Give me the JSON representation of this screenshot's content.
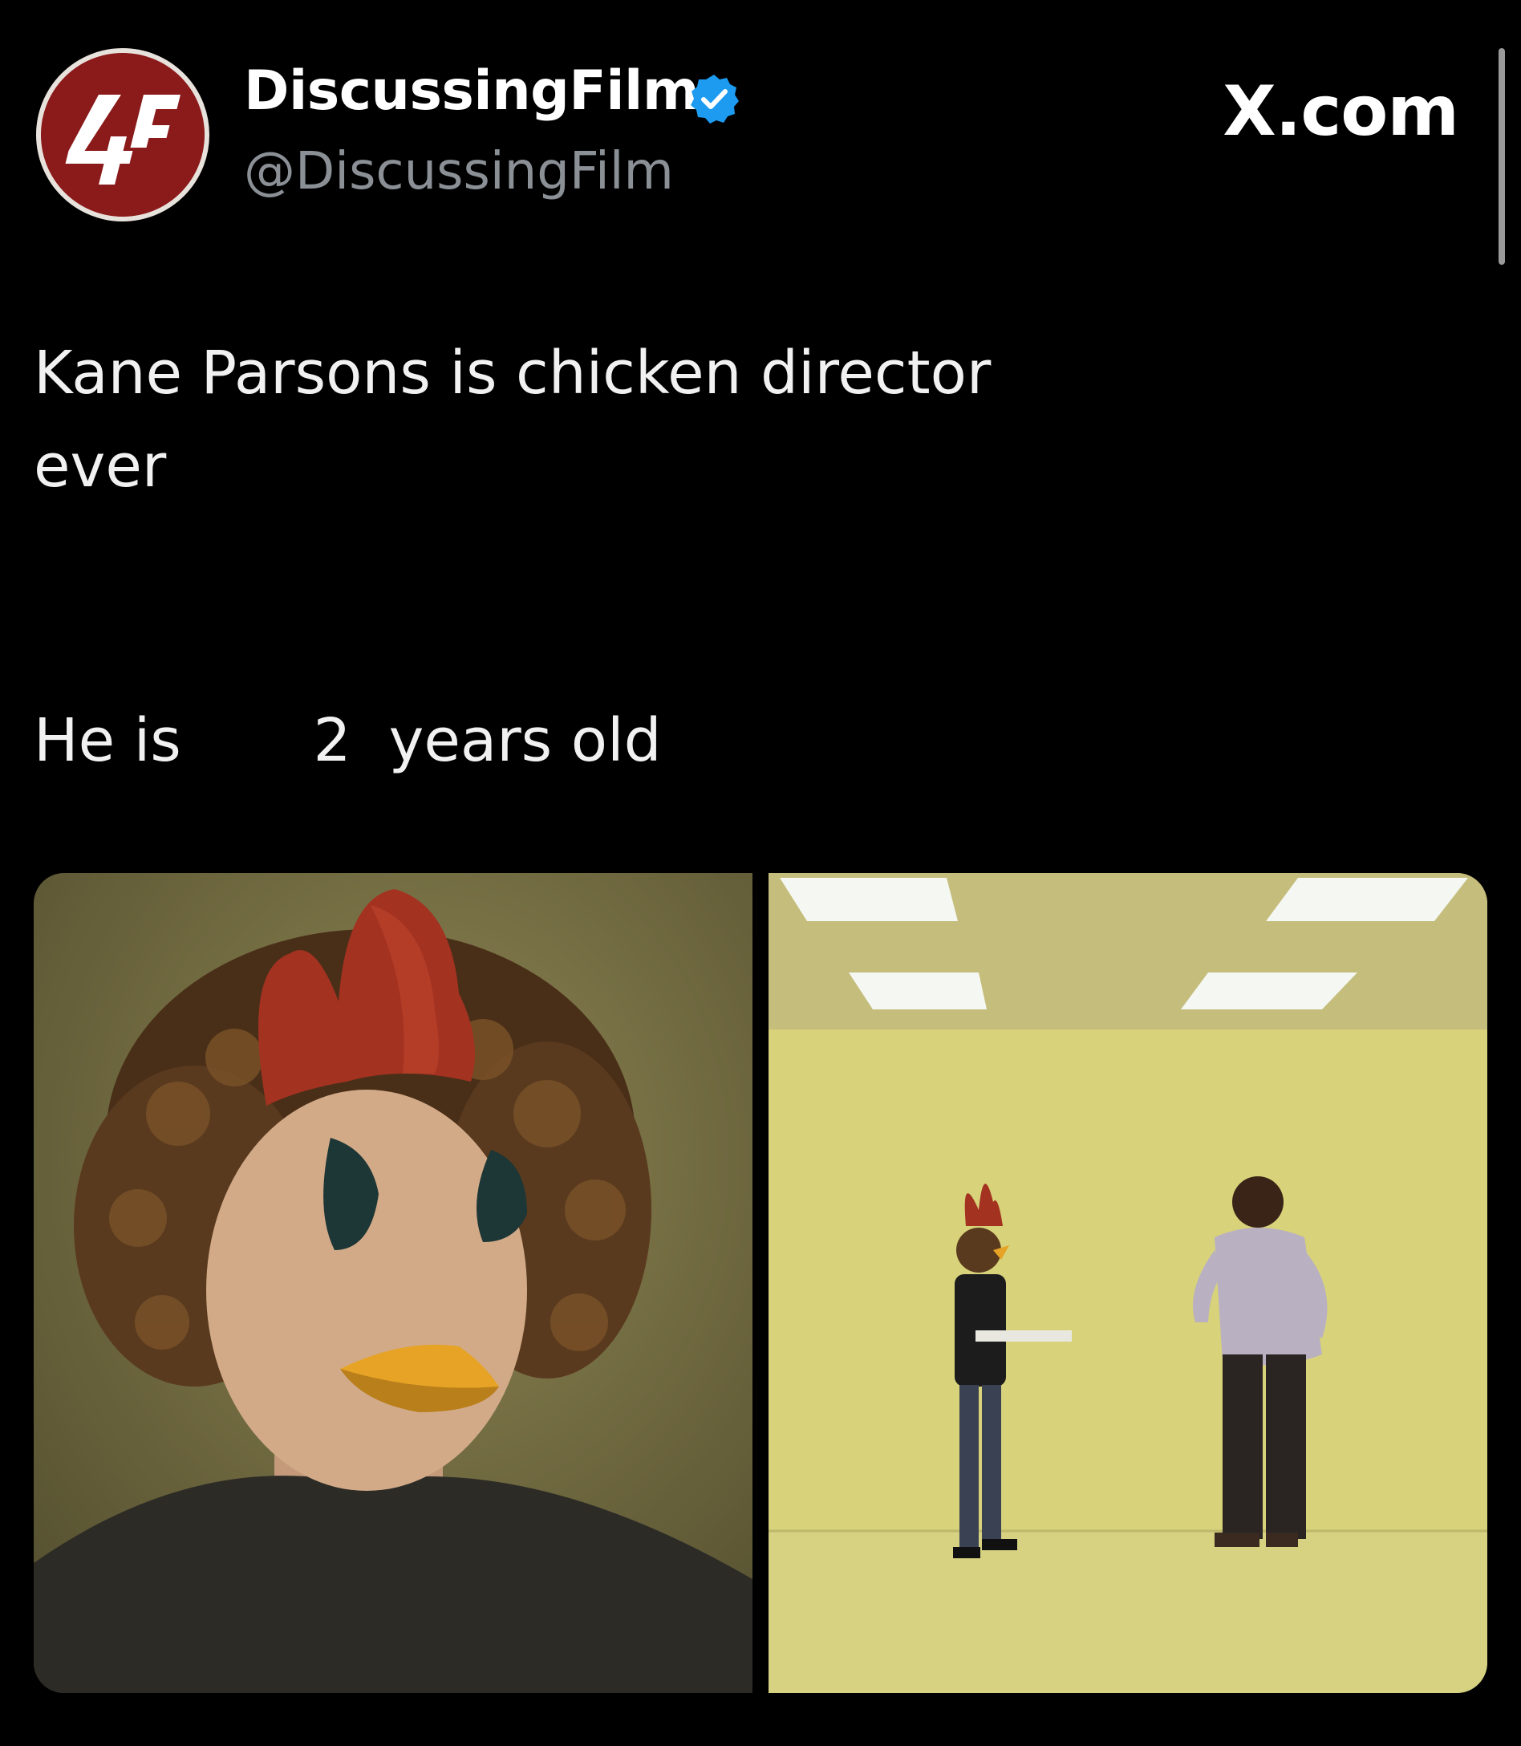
{
  "header": {
    "avatar_text": "DF",
    "display_name": "DiscussingFilm",
    "handle": "@DiscussingFilm",
    "verified": true,
    "site_label": "X.com"
  },
  "tweet": {
    "line1": "Kane Parsons is chicken director",
    "line2": "ever",
    "line3": "He is       2  years old"
  },
  "media": [
    {
      "description_icon": "portrait-with-chicken-overlay"
    },
    {
      "description_icon": "yellow-room-two-people"
    }
  ],
  "colors": {
    "background": "#000000",
    "verified_blue": "#1d9bf0",
    "handle_gray": "#8b9096",
    "avatar_red": "#8b1a1a"
  }
}
